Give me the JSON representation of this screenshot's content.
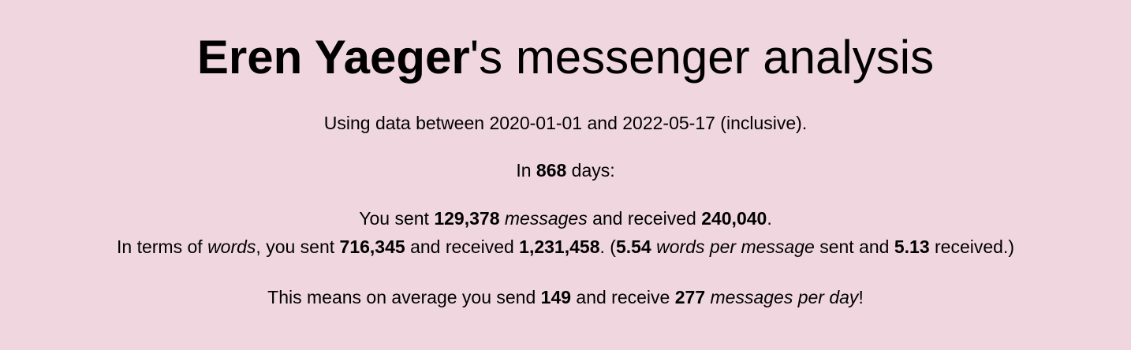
{
  "title": {
    "name": "Eren Yaeger",
    "suffix": "'s messenger analysis"
  },
  "date_range": {
    "prefix": "Using data between ",
    "start": "2020-01-01",
    "middle": " and ",
    "end": "2022-05-17",
    "suffix": " (inclusive)."
  },
  "days": {
    "prefix": "In ",
    "count": "868",
    "suffix": " days:"
  },
  "messages": {
    "prefix": "You sent ",
    "sent": "129,378",
    "unit_space": " ",
    "unit": "messages",
    "middle": " and received ",
    "received": "240,040",
    "suffix": "."
  },
  "words": {
    "prefix": "In terms of ",
    "unit": "words",
    "after_unit": ", you sent ",
    "sent": "716,345",
    "middle": " and received ",
    "received": "1,231,458",
    "paren_open": ". (",
    "per_sent": "5.54",
    "per_unit_space": " ",
    "per_unit": "words per message",
    "per_middle": " sent and ",
    "per_received": "5.13",
    "suffix": " received.)"
  },
  "average": {
    "prefix": "This means on average you send ",
    "send": "149",
    "middle": " and receive ",
    "receive": "277",
    "unit_space": " ",
    "unit": "messages per day",
    "suffix": "!"
  }
}
